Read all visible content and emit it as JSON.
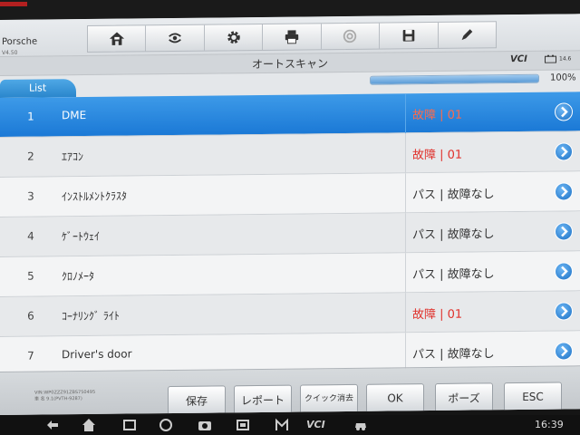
{
  "vehicle": {
    "make": "Porsche",
    "version": "V4.50"
  },
  "toolbar": {
    "buttons": [
      {
        "icon": "home-icon"
      },
      {
        "icon": "vehicle-swap-icon"
      },
      {
        "icon": "gear-icon"
      },
      {
        "icon": "printer-icon"
      },
      {
        "icon": "help-icon",
        "disabled": true
      },
      {
        "icon": "save-icon"
      },
      {
        "icon": "pen-icon"
      }
    ]
  },
  "titlebar": {
    "title": "オートスキャン",
    "vci": "VCI",
    "battery": "14.6"
  },
  "tab": {
    "label": "List"
  },
  "progress": {
    "value": 1.0,
    "label": "100%"
  },
  "modules": [
    {
      "num": "1",
      "name": "DME",
      "status": "故障 | 01",
      "fault": true,
      "selected": true
    },
    {
      "num": "2",
      "name": "ｴｱｺﾝ",
      "status": "故障 | 01",
      "fault": true
    },
    {
      "num": "3",
      "name": "ｲﾝｽﾄﾙﾒﾝﾄｸﾗｽﾀ",
      "status": "パス | 故障なし",
      "fault": false
    },
    {
      "num": "4",
      "name": "ｹﾞｰﾄｳｪｲ",
      "status": "パス | 故障なし",
      "fault": false
    },
    {
      "num": "5",
      "name": "ｸﾛﾉﾒｰﾀ",
      "status": "パス | 故障なし",
      "fault": false
    },
    {
      "num": "6",
      "name": "ｺｰﾅﾘﾝｸﾞ ﾗｲﾄ",
      "status": "故障 | 01",
      "fault": true
    },
    {
      "num": "7",
      "name": "Driver's door",
      "status": "パス | 故障なし",
      "fault": false
    }
  ],
  "footer": {
    "vin_line1": "VIN:WP0ZZZ91ZBS750495",
    "vin_line2": "車 名 9.1(PVTH-9287)",
    "buttons": [
      "保存",
      "レポート",
      "クイック消去",
      "OK",
      "ポーズ",
      "ESC"
    ]
  },
  "nav": {
    "time": "16:39",
    "vci_label": "VCI"
  },
  "colors": {
    "accent": "#1b79d6",
    "fault": "#e0302a",
    "bg": "#e4e7ea"
  }
}
